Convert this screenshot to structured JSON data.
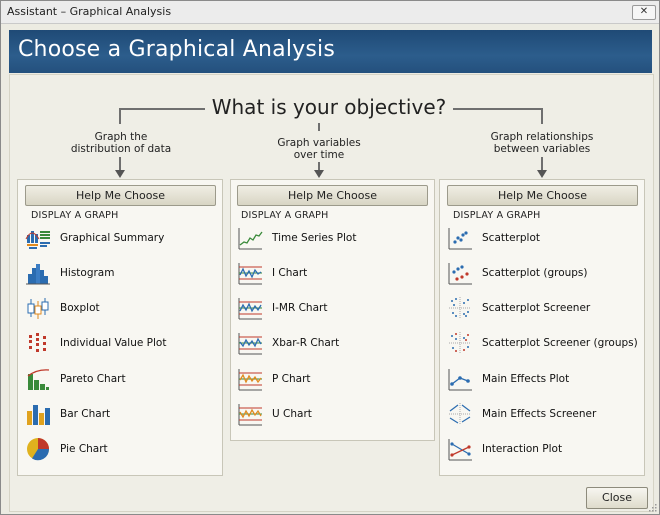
{
  "window": {
    "title": "Assistant – Graphical Analysis",
    "close_glyph": "✕"
  },
  "header": {
    "title": "Choose a Graphical Analysis"
  },
  "objective": {
    "question": "What is your objective?"
  },
  "columns": [
    {
      "heading": "Graph the\ndistribution of data",
      "help_label": "Help Me Choose",
      "section_label": "DISPLAY A GRAPH",
      "items": [
        {
          "label": "Graphical Summary",
          "icon": "graphical-summary-icon"
        },
        {
          "label": "Histogram",
          "icon": "histogram-icon"
        },
        {
          "label": "Boxplot",
          "icon": "boxplot-icon"
        },
        {
          "label": "Individual Value Plot",
          "icon": "individual-value-plot-icon"
        },
        {
          "label": "Pareto Chart",
          "icon": "pareto-chart-icon"
        },
        {
          "label": "Bar Chart",
          "icon": "bar-chart-icon"
        },
        {
          "label": "Pie Chart",
          "icon": "pie-chart-icon"
        }
      ]
    },
    {
      "heading": "Graph variables\nover time",
      "help_label": "Help Me Choose",
      "section_label": "DISPLAY A GRAPH",
      "items": [
        {
          "label": "Time Series Plot",
          "icon": "time-series-plot-icon"
        },
        {
          "label": "I Chart",
          "icon": "i-chart-icon"
        },
        {
          "label": "I-MR Chart",
          "icon": "i-mr-chart-icon"
        },
        {
          "label": "Xbar-R Chart",
          "icon": "xbar-r-chart-icon"
        },
        {
          "label": "P Chart",
          "icon": "p-chart-icon"
        },
        {
          "label": "U Chart",
          "icon": "u-chart-icon"
        }
      ]
    },
    {
      "heading": "Graph relationships\nbetween variables",
      "help_label": "Help Me Choose",
      "section_label": "DISPLAY A GRAPH",
      "items": [
        {
          "label": "Scatterplot",
          "icon": "scatterplot-icon"
        },
        {
          "label": "Scatterplot (groups)",
          "icon": "scatterplot-groups-icon"
        },
        {
          "label": "Scatterplot Screener",
          "icon": "scatterplot-screener-icon"
        },
        {
          "label": "Scatterplot Screener (groups)",
          "icon": "scatterplot-screener-groups-icon"
        },
        {
          "label": "Main Effects Plot",
          "icon": "main-effects-plot-icon"
        },
        {
          "label": "Main Effects Screener",
          "icon": "main-effects-screener-icon"
        },
        {
          "label": "Interaction Plot",
          "icon": "interaction-plot-icon"
        }
      ]
    }
  ],
  "footer": {
    "close_label": "Close"
  },
  "colors": {
    "header_blue": "#2c5d8c",
    "accent_orange": "#e08a1e",
    "chart_blue": "#2b6cb0",
    "chart_red": "#c0392b",
    "chart_green": "#3a8a3a"
  }
}
